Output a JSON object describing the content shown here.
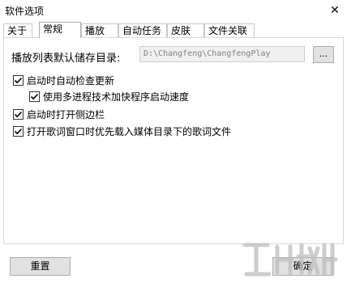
{
  "window": {
    "title": "软件选项",
    "close_glyph": "✕"
  },
  "tabs": [
    {
      "label": "关于",
      "active": false
    },
    {
      "label": "常规",
      "active": true
    },
    {
      "label": "播放",
      "active": false
    },
    {
      "label": "自动任务",
      "active": false
    },
    {
      "label": "皮肤",
      "active": false
    },
    {
      "label": "文件关联",
      "active": false
    }
  ],
  "general": {
    "playlist_dir_label": "播放列表默认储存目录:",
    "playlist_dir_value": "D:\\Changfeng\\ChangfengPlay",
    "browse_label": "...",
    "options": [
      {
        "label": "启动时自动检查更新",
        "checked": true
      },
      {
        "label": "使用多进程技术加快程序启动速度",
        "checked": true
      },
      {
        "label": "启动时打开侧边栏",
        "checked": true
      },
      {
        "label": "打开歌词窗口时优先载入媒体目录下的歌词文件",
        "checked": true
      }
    ]
  },
  "buttons": {
    "reset_label": "重置",
    "ok_label": "确定"
  },
  "watermark": {
    "icon": "download-site-logo"
  }
}
